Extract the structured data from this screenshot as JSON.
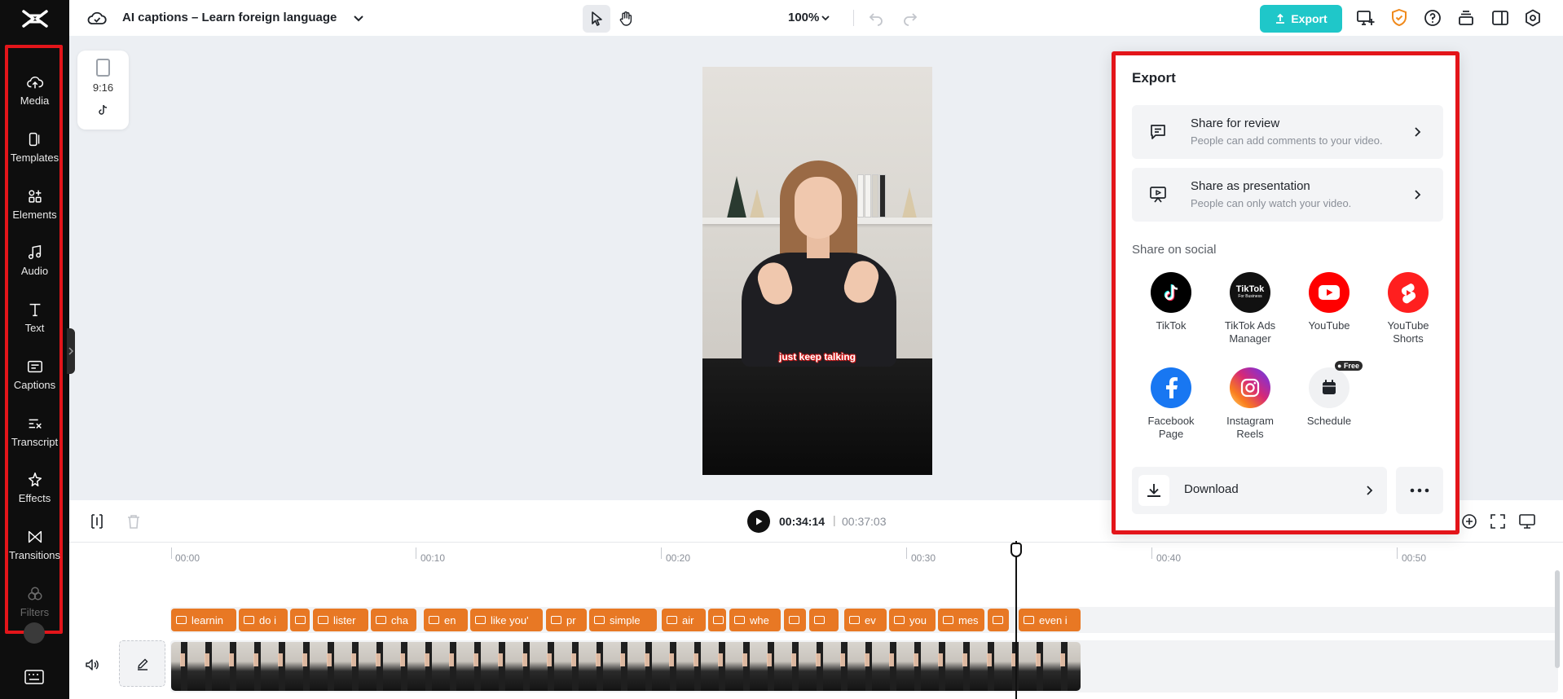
{
  "project": {
    "title": "AI captions – Learn foreign language"
  },
  "toolbar": {
    "zoom": "100%",
    "export_label": "Export"
  },
  "rail": {
    "items": [
      {
        "label": "Media",
        "icon": "cloud-upload-icon"
      },
      {
        "label": "Templates",
        "icon": "templates-icon"
      },
      {
        "label": "Elements",
        "icon": "elements-icon"
      },
      {
        "label": "Audio",
        "icon": "music-note-icon"
      },
      {
        "label": "Text",
        "icon": "text-icon"
      },
      {
        "label": "Captions",
        "icon": "captions-icon"
      },
      {
        "label": "Transcript",
        "icon": "transcript-icon"
      },
      {
        "label": "Effects",
        "icon": "effects-icon"
      },
      {
        "label": "Transitions",
        "icon": "transitions-icon"
      },
      {
        "label": "Filters",
        "icon": "filters-icon"
      }
    ]
  },
  "canvas": {
    "ratio": "9:16",
    "caption_text": "just keep talking"
  },
  "export_panel": {
    "title": "Export",
    "share_review": {
      "title": "Share for review",
      "subtitle": "People can add comments to your video."
    },
    "share_presentation": {
      "title": "Share as presentation",
      "subtitle": "People can only watch your video."
    },
    "share_social_label": "Share on social",
    "socials": [
      {
        "name": "TikTok",
        "color": "#000000"
      },
      {
        "name": "TikTok Ads Manager",
        "color": "#111111",
        "logo_text": "TikTok",
        "logo_sub": "For Business"
      },
      {
        "name": "YouTube",
        "color": "#ff0000"
      },
      {
        "name": "YouTube Shorts",
        "color": "#ff1f1f"
      },
      {
        "name": "Facebook Page",
        "color": "#1877f2"
      },
      {
        "name": "Instagram Reels",
        "color": "#d62976"
      },
      {
        "name": "Schedule",
        "color": "#f0f1f3",
        "badge": "Free"
      }
    ],
    "download_label": "Download"
  },
  "player": {
    "current_time": "00:34:14",
    "separator": "|",
    "total_time": "00:37:03"
  },
  "timeline": {
    "ruler": [
      "00:00",
      "00:10",
      "00:20",
      "00:30",
      "00:40",
      "00:50"
    ],
    "captions": [
      "learnin",
      "do i",
      "",
      "lister",
      "cha",
      "en",
      "like you'",
      "pr",
      "simple",
      "air",
      "",
      "whe",
      "",
      "",
      "ev",
      "you",
      "mes",
      "",
      "even i"
    ]
  }
}
